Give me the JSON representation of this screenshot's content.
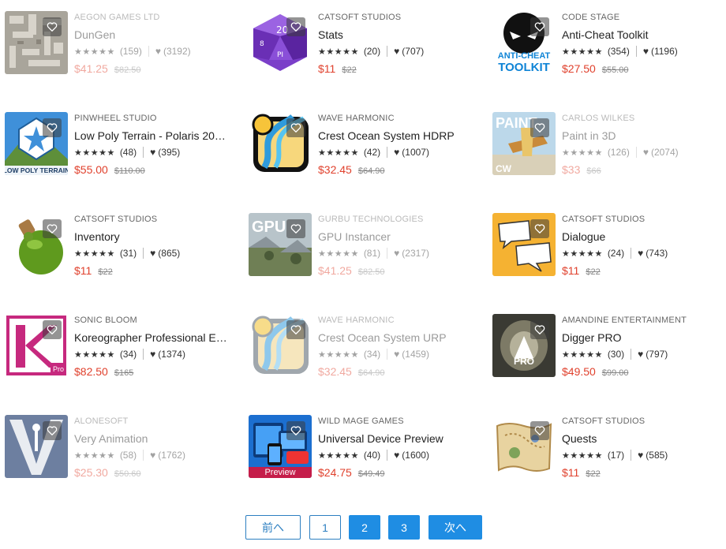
{
  "products": [
    {
      "publisher": "AEGON GAMES LTD",
      "title": "DunGen",
      "rating_count": "(159)",
      "favorites": "(3192)",
      "price": "$41.25",
      "original_price": "$82.50",
      "dimmed": true
    },
    {
      "publisher": "CATSOFT STUDIOS",
      "title": "Stats",
      "rating_count": "(20)",
      "favorites": "(707)",
      "price": "$11",
      "original_price": "$22",
      "dimmed": false
    },
    {
      "publisher": "CODE STAGE",
      "title": "Anti-Cheat Toolkit",
      "rating_count": "(354)",
      "favorites": "(1196)",
      "price": "$27.50",
      "original_price": "$55.00",
      "dimmed": false
    },
    {
      "publisher": "PINWHEEL STUDIO",
      "title": "Low Poly Terrain - Polaris 20…",
      "rating_count": "(48)",
      "favorites": "(395)",
      "price": "$55.00",
      "original_price": "$110.00",
      "dimmed": false,
      "thumb_text": "LOW POLY TERRAIN"
    },
    {
      "publisher": "WAVE HARMONIC",
      "title": "Crest Ocean System HDRP",
      "rating_count": "(42)",
      "favorites": "(1007)",
      "price": "$32.45",
      "original_price": "$64.90",
      "dimmed": false
    },
    {
      "publisher": "CARLOS WILKES",
      "title": "Paint in 3D",
      "rating_count": "(126)",
      "favorites": "(2074)",
      "price": "$33",
      "original_price": "$66",
      "dimmed": true,
      "thumb_text": "PAINT"
    },
    {
      "publisher": "CATSOFT STUDIOS",
      "title": "Inventory",
      "rating_count": "(31)",
      "favorites": "(865)",
      "price": "$11",
      "original_price": "$22",
      "dimmed": false
    },
    {
      "publisher": "GURBU TECHNOLOGIES",
      "title": "GPU Instancer",
      "rating_count": "(81)",
      "favorites": "(2317)",
      "price": "$41.25",
      "original_price": "$82.50",
      "dimmed": true,
      "thumb_text": "GPU"
    },
    {
      "publisher": "CATSOFT STUDIOS",
      "title": "Dialogue",
      "rating_count": "(24)",
      "favorites": "(743)",
      "price": "$11",
      "original_price": "$22",
      "dimmed": false
    },
    {
      "publisher": "SONIC BLOOM",
      "title": "Koreographer Professional E…",
      "rating_count": "(34)",
      "favorites": "(1374)",
      "price": "$82.50",
      "original_price": "$165",
      "dimmed": false,
      "thumb_text": "Pro"
    },
    {
      "publisher": "WAVE HARMONIC",
      "title": "Crest Ocean System URP",
      "rating_count": "(34)",
      "favorites": "(1459)",
      "price": "$32.45",
      "original_price": "$64.90",
      "dimmed": true
    },
    {
      "publisher": "AMANDINE ENTERTAINMENT",
      "title": "Digger PRO",
      "rating_count": "(30)",
      "favorites": "(797)",
      "price": "$49.50",
      "original_price": "$99.00",
      "dimmed": false,
      "thumb_text": "PRO"
    },
    {
      "publisher": "ALONESOFT",
      "title": "Very Animation",
      "rating_count": "(58)",
      "favorites": "(1762)",
      "price": "$25.30",
      "original_price": "$50.60",
      "dimmed": true
    },
    {
      "publisher": "WILD MAGE GAMES",
      "title": "Universal Device Preview",
      "rating_count": "(40)",
      "favorites": "(1600)",
      "price": "$24.75",
      "original_price": "$49.49",
      "dimmed": false,
      "thumb_caption": "Preview"
    },
    {
      "publisher": "CATSOFT STUDIOS",
      "title": "Quests",
      "rating_count": "(17)",
      "favorites": "(585)",
      "price": "$11",
      "original_price": "$22",
      "dimmed": false
    }
  ],
  "anticheat_thumb": {
    "line1": "ANTI-CHEAT",
    "line2": "TOOLKIT"
  },
  "stars": "★★★★★",
  "heart_glyph": "♥",
  "pagination": {
    "prev": "前へ",
    "pages": [
      "1",
      "2",
      "3"
    ],
    "current_page": "2",
    "next": "次へ"
  },
  "colors": {
    "price": "#e0412d",
    "accent": "#1f8de3"
  }
}
